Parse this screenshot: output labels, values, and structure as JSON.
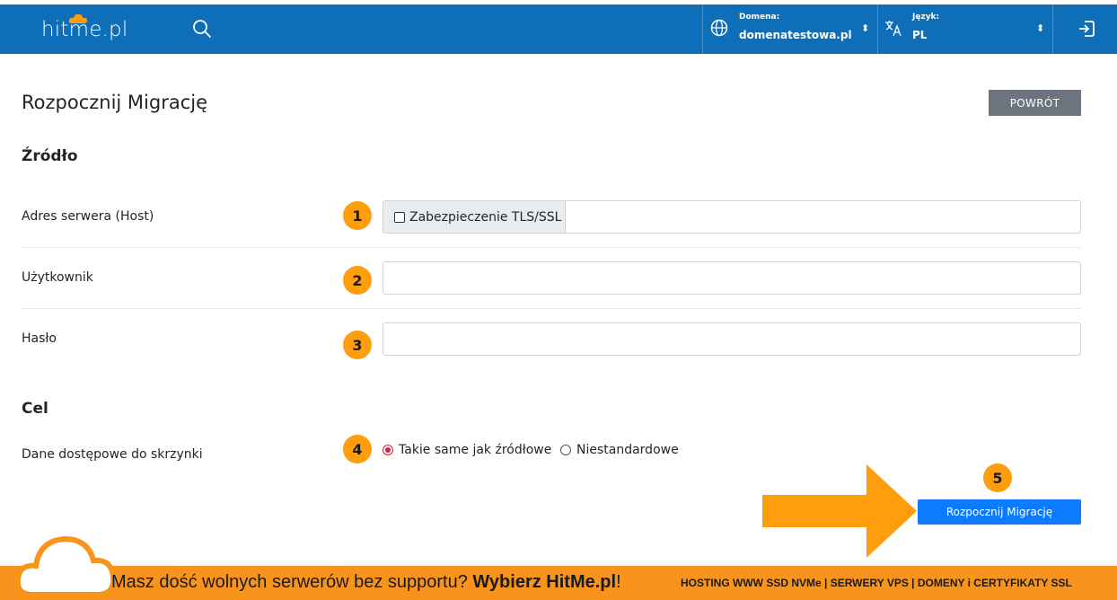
{
  "header": {
    "logo_text": "hitme.pl",
    "search_icon": "search-icon",
    "domain": {
      "caption": "Domena:",
      "value": "domenatestowa.pl",
      "icon": "globe-icon"
    },
    "language": {
      "caption": "Język:",
      "value": "PL",
      "icon": "translate-icon"
    },
    "logout_icon": "logout-icon",
    "bg_color": "#0e6eb8"
  },
  "page": {
    "title": "Rozpocznij Migrację",
    "back_button": "POWRÓT"
  },
  "source": {
    "section_title": "Źródło",
    "host_label": "Adres serwera (Host)",
    "tls_label": "Zabezpieczenie TLS/SSL",
    "tls_checked": false,
    "host_value": "",
    "user_label": "Użytkownik",
    "user_value": "",
    "password_label": "Hasło",
    "password_value": ""
  },
  "target": {
    "section_title": "Cel",
    "credentials_label": "Dane dostępowe do skrzynki",
    "options": [
      {
        "label": "Takie same jak źródłowe",
        "selected": true
      },
      {
        "label": "Niestandardowe",
        "selected": false
      }
    ]
  },
  "actions": {
    "start_button": "Rozpocznij Migrację"
  },
  "badges": [
    "1",
    "2",
    "3",
    "4",
    "5"
  ],
  "footer": {
    "text_regular": "Masz dość wolnych serwerów bez supportu? ",
    "text_bold": "Wybierz HitMe.pl",
    "text_end": "!",
    "right_text": "HOSTING WWW SSD NVMe | SERWERY VPS | DOMENY i CERTYFIKATY SSL",
    "bg_color": "#f8941c"
  },
  "colors": {
    "badge": "#ff9e0d",
    "primary_button": "#0d7bff",
    "secondary_button": "#6c757d",
    "radio_selected": "#dc1f3a"
  }
}
